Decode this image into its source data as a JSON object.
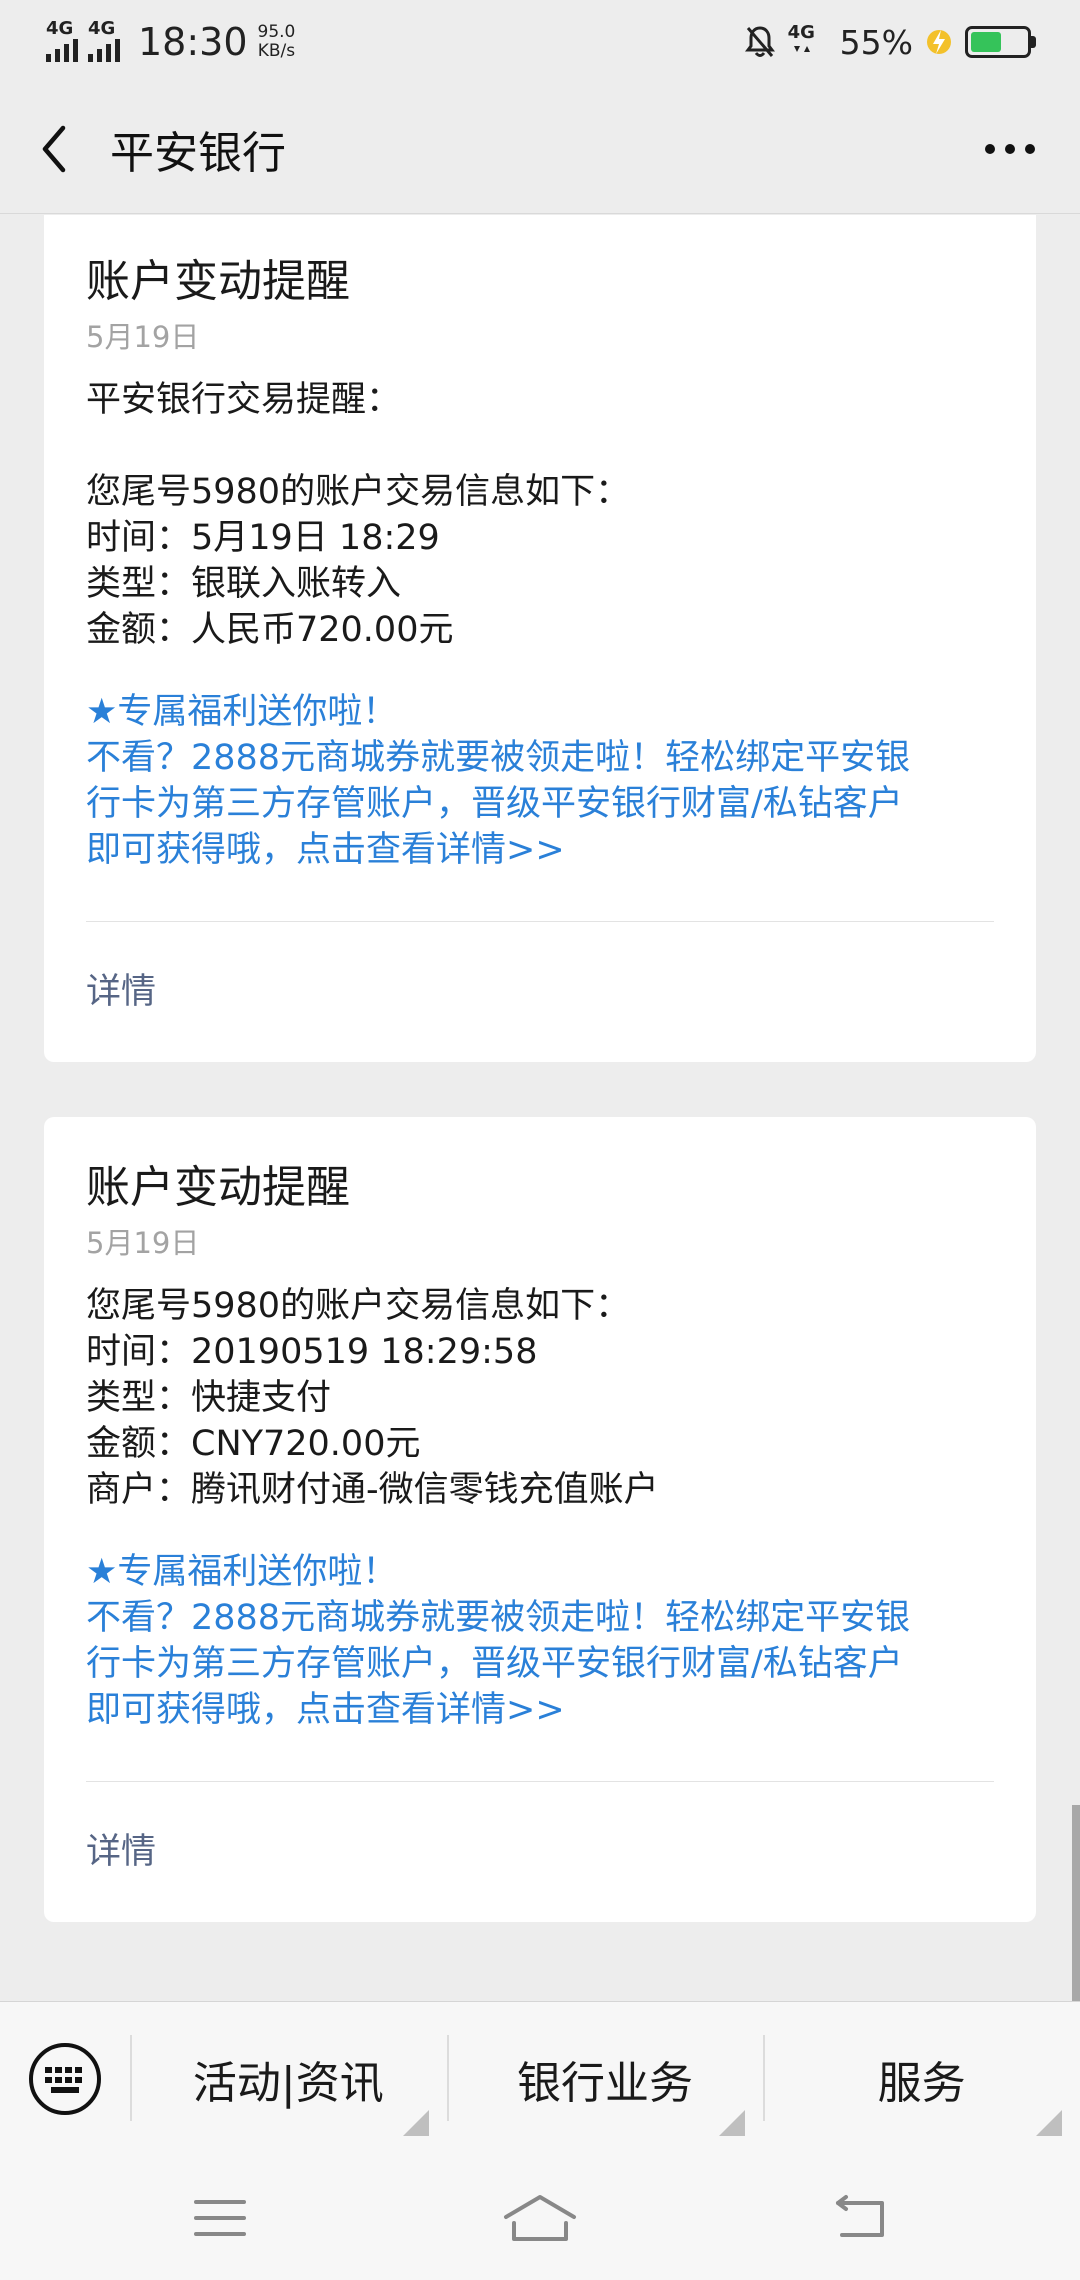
{
  "status_bar": {
    "network_1": "4G",
    "network_2": "4G",
    "time": "18:30",
    "speed_value": "95.0",
    "speed_unit": "KB/s",
    "network_3": "4G",
    "battery_percent": "55%",
    "battery_level": 0.55,
    "battery_color": "#35c35a"
  },
  "header": {
    "back_icon": "chevron-left-icon",
    "title": "平安银行",
    "more_icon": "more-icon"
  },
  "messages": [
    {
      "title": "账户变动提醒",
      "date": "5月19日",
      "lines": [
        "平安银行交易提醒：",
        "",
        "您尾号5980的账户交易信息如下：",
        "时间：5月19日 18:29",
        "类型：银联入账转入",
        "金额：人民币720.00元"
      ],
      "promo": [
        "★专属福利送你啦！",
        "不看？2888元商城券就要被领走啦！轻松绑定平安银",
        "行卡为第三方存管账户，晋级平安银行财富/私钻客户",
        "即可获得哦，点击查看详情>>"
      ],
      "detail_label": "详情"
    },
    {
      "title": "账户变动提醒",
      "date": "5月19日",
      "lines": [
        "您尾号5980的账户交易信息如下：",
        "时间：20190519 18:29:58",
        "类型：快捷支付",
        "金额：CNY720.00元",
        "商户：腾讯财付通-微信零钱充值账户"
      ],
      "promo": [
        "★专属福利送你啦！",
        "不看？2888元商城券就要被领走啦！轻松绑定平安银",
        "行卡为第三方存管账户，晋级平安银行财富/私钻客户",
        "即可获得哦，点击查看详情>>"
      ],
      "detail_label": "详情"
    }
  ],
  "menu": {
    "keyboard_icon": "keyboard-icon",
    "items": [
      "活动|资讯",
      "银行业务",
      "服务"
    ]
  },
  "nav": {
    "icons": [
      "menu-icon",
      "home-icon",
      "back-icon"
    ]
  },
  "colors": {
    "link": "#2a80d8",
    "detail": "#566585",
    "background": "#ededed"
  }
}
